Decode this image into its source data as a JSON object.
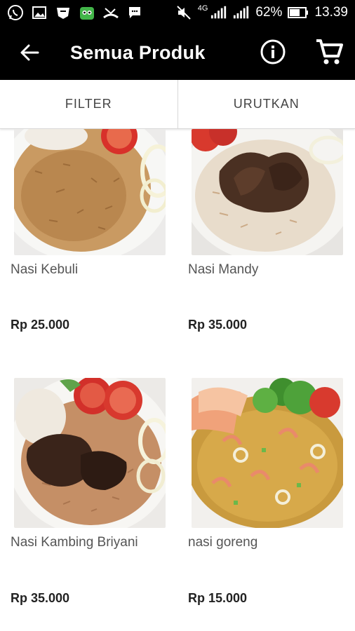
{
  "status_bar": {
    "battery": "62%",
    "time": "13.39",
    "network": "4G",
    "icons": [
      "whatsapp-icon",
      "gallery-icon",
      "shield-icon",
      "tokopedia-icon",
      "missed-call-icon",
      "message-icon",
      "mute-icon",
      "signal-icon",
      "battery-icon"
    ]
  },
  "app_bar": {
    "title": "Semua Produk",
    "icons": [
      "back-arrow-icon",
      "info-icon",
      "cart-icon"
    ]
  },
  "tabs": {
    "filter": "FILTER",
    "sort": "URUTKAN"
  },
  "products": [
    {
      "name": "Nasi Kebuli",
      "price": "Rp 25.000",
      "image": "kebuli rice plate"
    },
    {
      "name": "Nasi Mandy",
      "price": "Rp 35.000",
      "image": "mandy rice with meat"
    },
    {
      "name": "Nasi Kambing Briyani",
      "price": "Rp 35.000",
      "image": "briyani rice with lamb"
    },
    {
      "name": "nasi goreng",
      "price": "Rp 15.000",
      "image": "seafood fried rice"
    }
  ],
  "colors": {
    "app_bar": "#000000",
    "background": "#ffffff",
    "divider": "#d8d8d8"
  }
}
